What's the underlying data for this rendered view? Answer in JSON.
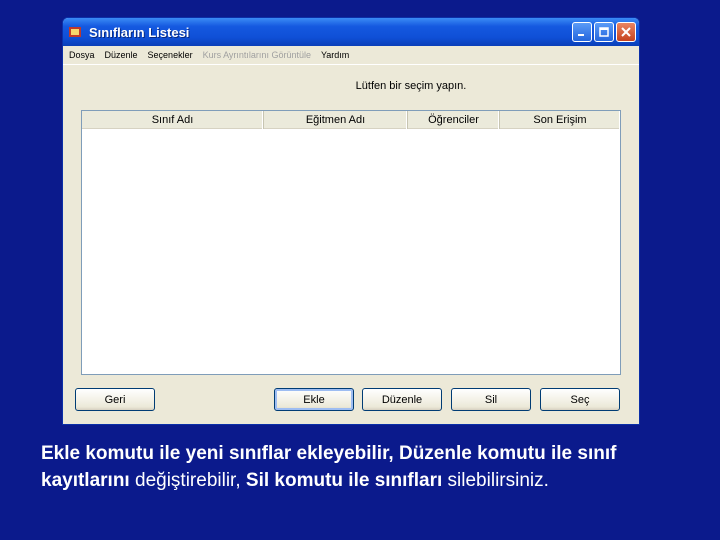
{
  "window": {
    "title": "Sınıfların Listesi",
    "controls": {
      "minimize_icon": "minimize-icon",
      "restore_icon": "restore-icon",
      "close_icon": "close-icon"
    }
  },
  "menu": {
    "items": [
      "Dosya",
      "Düzenle",
      "Seçenekler",
      "Kurs Ayrıntılarını Görüntüle",
      "Yardım"
    ],
    "disabled_index": 3
  },
  "prompt": "Lütfen bir seçim yapın.",
  "list": {
    "columns": [
      "Sınıf Adı",
      "Eğitmen Adı",
      "Öğrenciler",
      "Son Erişim"
    ],
    "rows": []
  },
  "buttons": {
    "geri": "Geri",
    "ekle": "Ekle",
    "duzenle": "Düzenle",
    "sil": "Sil",
    "sec": "Seç"
  },
  "caption": {
    "p1": "Ekle komutu ile yeni sınıflar ekleyebilir, Düzenle komutu ile sınıf kayıtlarını",
    "p2": " değiştirebilir, ",
    "p3": "Sil komutu ile sınıfları",
    "p4": " silebilirsiniz."
  },
  "colors": {
    "background": "#0b1a8c",
    "titlebar": "#0f4fd6",
    "window": "#ece9d8"
  }
}
